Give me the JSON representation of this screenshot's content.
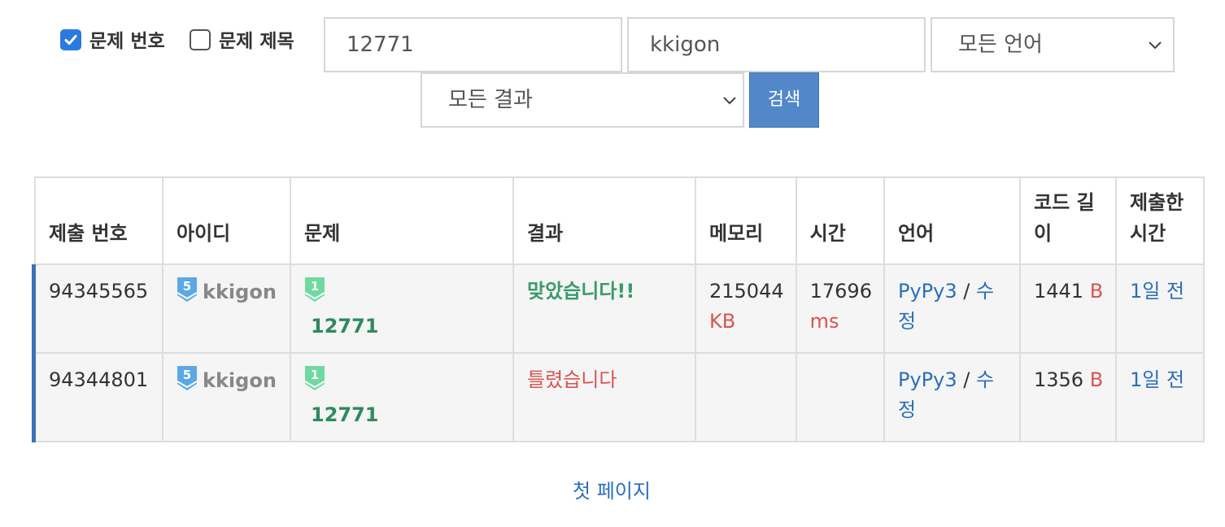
{
  "filters": {
    "problem_number_checkbox": {
      "label": "문제 번호",
      "checked": true
    },
    "problem_title_checkbox": {
      "label": "문제 제목",
      "checked": false
    },
    "problem_input_value": "12771",
    "user_input_value": "kkigon",
    "language_select_value": "모든 언어",
    "result_select_value": "모든 결과",
    "search_button_label": "검색"
  },
  "table": {
    "headers": [
      "제출 번호",
      "아이디",
      "문제",
      "결과",
      "메모리",
      "시간",
      "언어",
      "코드 길이",
      "제출한 시간"
    ],
    "rows": [
      {
        "submission_id": "94345565",
        "user_tier": "5",
        "user_id": "kkigon",
        "problem_tier": "1",
        "problem_id": "12771",
        "result": "맞았습니다!!",
        "memory": "215044",
        "memory_unit": "KB",
        "time": "17696",
        "time_unit": "ms",
        "language": "PyPy3",
        "separator": "/",
        "edit": "수정",
        "code_length": "1441",
        "code_length_unit": "B",
        "submitted": "1일 전"
      },
      {
        "submission_id": "94344801",
        "user_tier": "5",
        "user_id": "kkigon",
        "problem_tier": "1",
        "problem_id": "12771",
        "result": "틀렸습니다",
        "memory": "",
        "memory_unit": "",
        "time": "",
        "time_unit": "",
        "language": "PyPy3",
        "separator": "/",
        "edit": "수정",
        "code_length": "1356",
        "code_length_unit": "B",
        "submitted": "1일 전"
      }
    ]
  },
  "pagination": {
    "first_page": "첫 페이지"
  },
  "colors": {
    "link": "#2a6ebb",
    "accepted": "#3a9a6a",
    "wrong": "#d9534f",
    "search_button": "#5288c9",
    "user_tier_badge": "#5aa8e6",
    "problem_tier_badge": "#6fd9a0"
  }
}
